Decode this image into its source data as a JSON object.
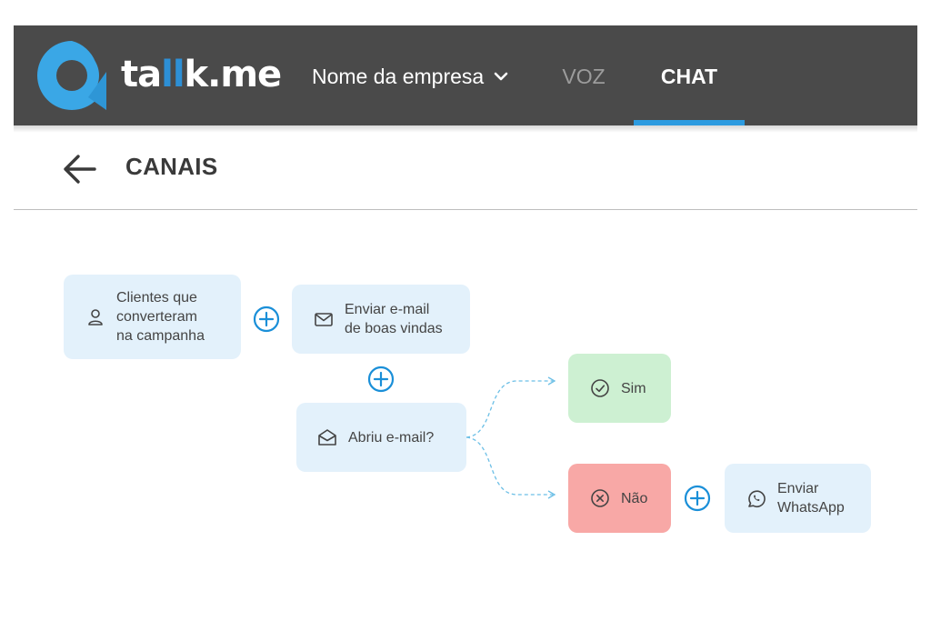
{
  "header": {
    "logo": {
      "prefix": "ta",
      "highlight": "ll",
      "suffix": "k.me"
    },
    "company_selector": "Nome da empresa",
    "tabs": [
      {
        "label": "VOZ",
        "active": false
      },
      {
        "label": "CHAT",
        "active": true
      }
    ],
    "accent_color": "#2d9be0"
  },
  "page": {
    "title": "CANAIS"
  },
  "flow": {
    "nodes": {
      "trigger": {
        "text": "Clientes que\nconverteram\nna campanha",
        "icon": "user-icon"
      },
      "send_email": {
        "text": "Enviar e-mail\nde boas vindas",
        "icon": "mail-icon"
      },
      "condition": {
        "text": "Abriu e-mail?",
        "icon": "mail-open-icon"
      },
      "yes": {
        "text": "Sim",
        "icon": "check-circle-icon"
      },
      "no": {
        "text": "Não",
        "icon": "x-circle-icon"
      },
      "whatsapp": {
        "text": "Enviar\nWhatsApp",
        "icon": "whatsapp-icon"
      }
    },
    "colors": {
      "action": "#e3f1fb",
      "yes": "#cdf0d2",
      "no": "#f8a8a6",
      "add": "#1a8fd8"
    }
  }
}
